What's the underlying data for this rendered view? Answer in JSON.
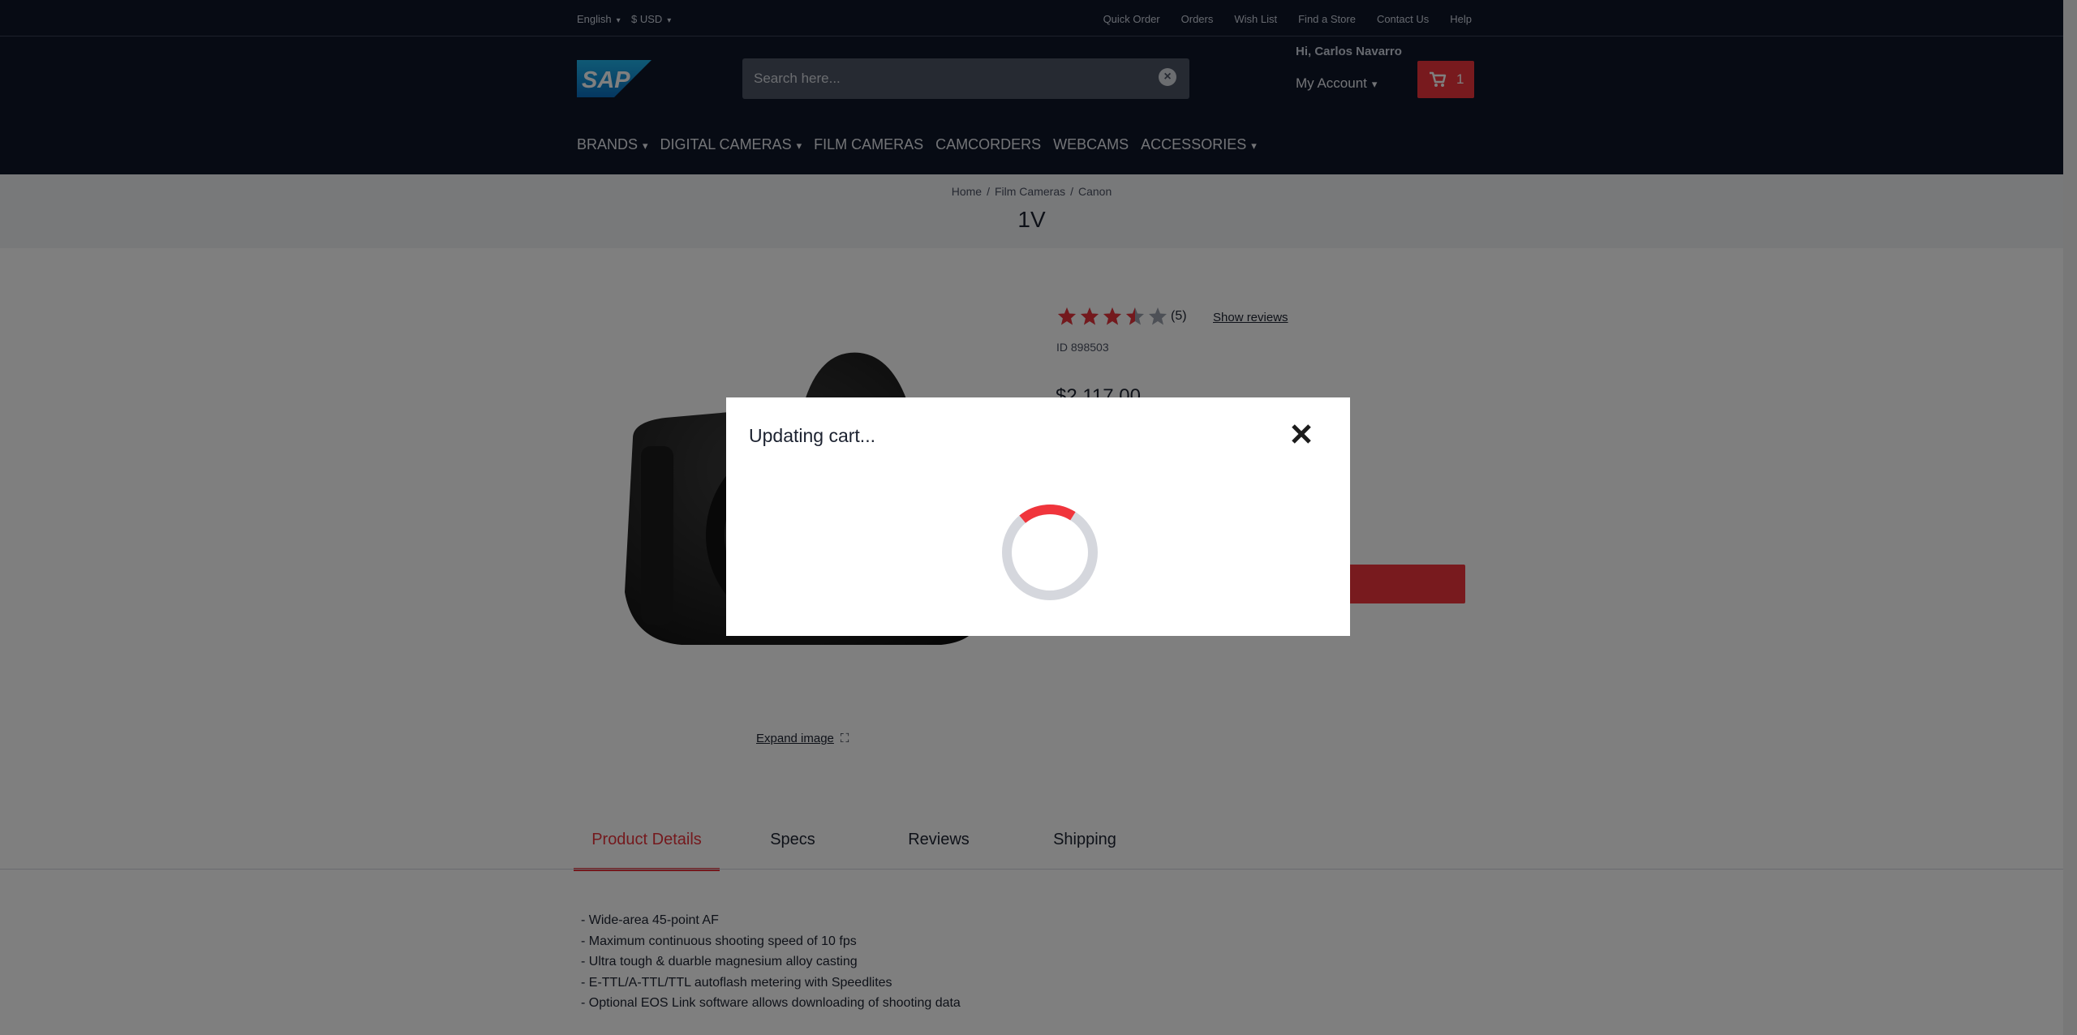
{
  "topbar": {
    "language": "English",
    "currency": "$ USD",
    "links": [
      "Quick Order",
      "Orders",
      "Wish List",
      "Find a Store",
      "Contact Us",
      "Help"
    ]
  },
  "header": {
    "logo_text": "SAP",
    "search_placeholder": "Search here...",
    "greeting": "Hi, Carlos Navarro",
    "account_label": "My Account",
    "cart_count": "1"
  },
  "nav": {
    "items": [
      {
        "label": "BRANDS",
        "has_menu": true
      },
      {
        "label": "DIGITAL CAMERAS",
        "has_menu": true
      },
      {
        "label": "FILM CAMERAS",
        "has_menu": false
      },
      {
        "label": "CAMCORDERS",
        "has_menu": false
      },
      {
        "label": "WEBCAMS",
        "has_menu": false
      },
      {
        "label": "ACCESSORIES",
        "has_menu": true
      }
    ]
  },
  "breadcrumb": [
    "Home",
    "Film Cameras",
    "Canon"
  ],
  "product": {
    "title": "1V",
    "rating": 3.5,
    "rating_max": 5,
    "review_count": "(5)",
    "show_reviews": "Show reviews",
    "id": "ID 898503",
    "price": "$2,117.00",
    "expand_image": "Expand image"
  },
  "tabs": [
    "Product Details",
    "Specs",
    "Reviews",
    "Shipping"
  ],
  "active_tab": 0,
  "details": [
    "- Wide-area 45-point AF",
    "- Maximum continuous shooting speed of 10 fps",
    "- Ultra tough & duarble magnesium alloy casting",
    "- E-TTL/A-TTL/TTL autoflash metering with Speedlites",
    "- Optional EOS Link software allows downloading of shooting data"
  ],
  "modal": {
    "title": "Updating cart...",
    "spinner_progress": 0.2
  },
  "colors": {
    "header_bg": "#0e1629",
    "accent": "#f0353c",
    "star_filled": "#e8333b",
    "star_empty": "#9aa0ac",
    "spinner_track": "#d5d7dd"
  }
}
